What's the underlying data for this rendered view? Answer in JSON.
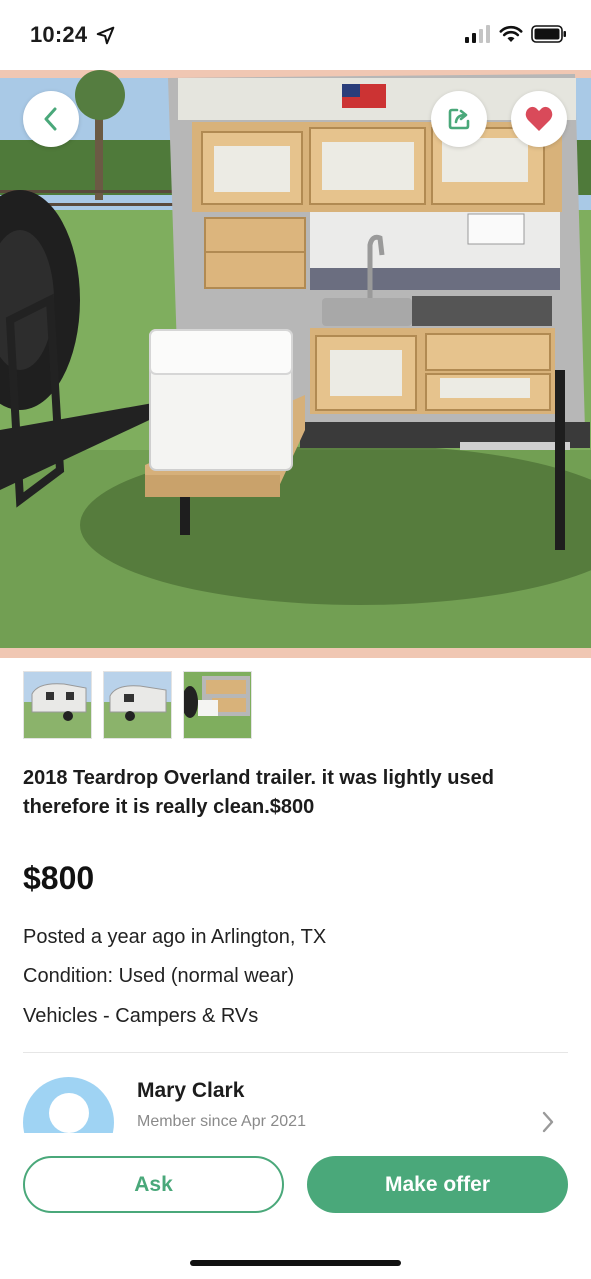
{
  "status_bar": {
    "time": "10:24",
    "icons": [
      "location-arrow-icon",
      "signal-icon",
      "wifi-icon",
      "battery-icon"
    ]
  },
  "hero": {
    "icons": {
      "back": "chevron-left-icon",
      "share": "share-icon",
      "favorite": "heart-icon"
    },
    "colors": {
      "back": "#4aa87a",
      "share": "#4aa87a",
      "favorite": "#d94a5a"
    },
    "thumbnail_count": 3
  },
  "listing": {
    "title": "2018 Teardrop Overland  trailer. it was lightly used therefore it is really clean.$800",
    "price": "$800",
    "posted": "Posted a year ago in Arlington, TX",
    "condition": "Condition: Used (normal wear)",
    "category": "Vehicles - Campers & RVs"
  },
  "seller": {
    "name": "Mary Clark",
    "member_since": "Member since Apr 2021"
  },
  "actions": {
    "ask_label": "Ask",
    "offer_label": "Make offer"
  },
  "colors": {
    "accent": "#4aa87a",
    "heart": "#d94a5a",
    "avatar_bg": "#9fd3f3"
  }
}
